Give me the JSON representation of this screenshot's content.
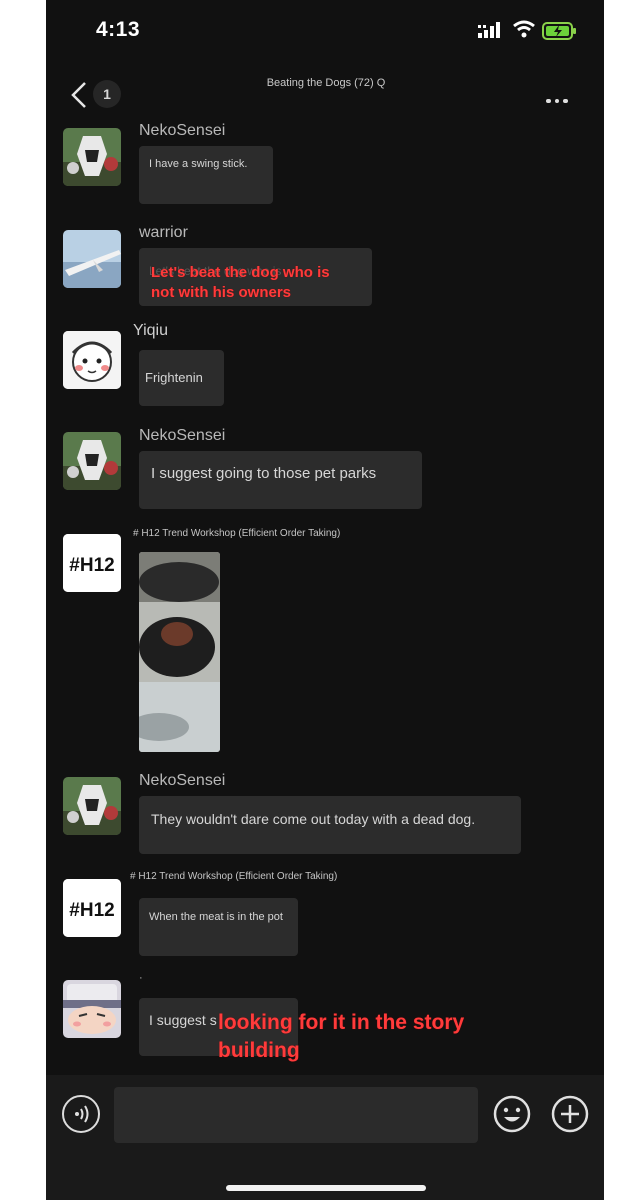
{
  "status_bar": {
    "time": "4:13"
  },
  "header": {
    "back_count": "1",
    "title": "Beating the Dogs (72) Q"
  },
  "messages": [
    {
      "sender": "NekoSensei",
      "text": "I have a swing stick."
    },
    {
      "sender": "warrior",
      "text": "Let's beat the dog who is",
      "caption": "Let's beat the dog who is not with his owners"
    },
    {
      "sender": "Yiqiu",
      "text": "Frightenin"
    },
    {
      "sender": "NekoSensei",
      "text": "I suggest going to those pet parks"
    },
    {
      "sender": "# H12 Trend Workshop (Efficient Order Taking)",
      "text": ""
    },
    {
      "sender": "NekoSensei",
      "text": "They wouldn't dare come out today with a dead dog."
    },
    {
      "sender": "# H12 Trend Workshop (Efficient Order Taking)",
      "text": "When the meat is in the pot"
    },
    {
      "sender": "·",
      "text": "I suggest s",
      "caption": "looking for it in the story building"
    }
  ],
  "h12_logo_text": "#H12",
  "icons": {
    "back": "chevron-left-icon",
    "more": "more-icon",
    "voice": "voice-icon",
    "emoji": "emoji-icon",
    "plus": "plus-icon"
  },
  "colors": {
    "background": "#111111",
    "bubble": "#2c2c2c",
    "caption": "#ff3b3b"
  },
  "input": {
    "value": ""
  }
}
